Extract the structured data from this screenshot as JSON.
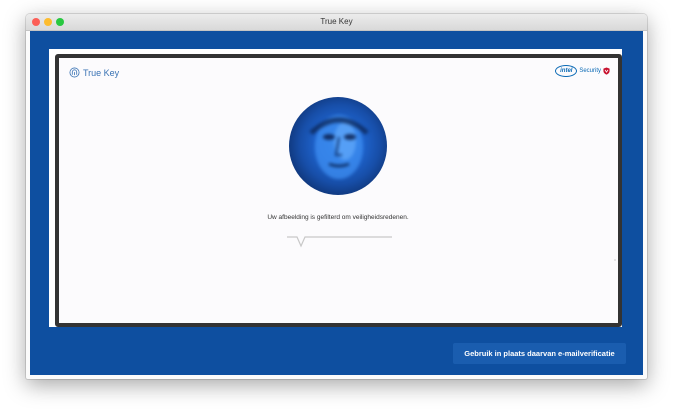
{
  "window": {
    "title": "True Key",
    "controls": [
      "close-button",
      "minimize-button",
      "zoom-button"
    ]
  },
  "brand": {
    "name": "True Key",
    "icon": "fingerprint-icon"
  },
  "partner": {
    "logo_text": "intel",
    "security_text": "Security",
    "shield_icon": "mcafee-shield-icon"
  },
  "face": {
    "icon": "filtered-face-photo"
  },
  "message": {
    "text": "Uw afbeelding is gefilterd om veiligheidsredenen."
  },
  "actions": {
    "email_button_label": "Gebruik in plaats daarvan e-mailverificatie"
  },
  "colors": {
    "app_background": "#0e4fa0",
    "frame": "#333333",
    "button": "#1a5daf",
    "brand_text": "#3a73b4",
    "intel_blue": "#0b6ab5"
  }
}
